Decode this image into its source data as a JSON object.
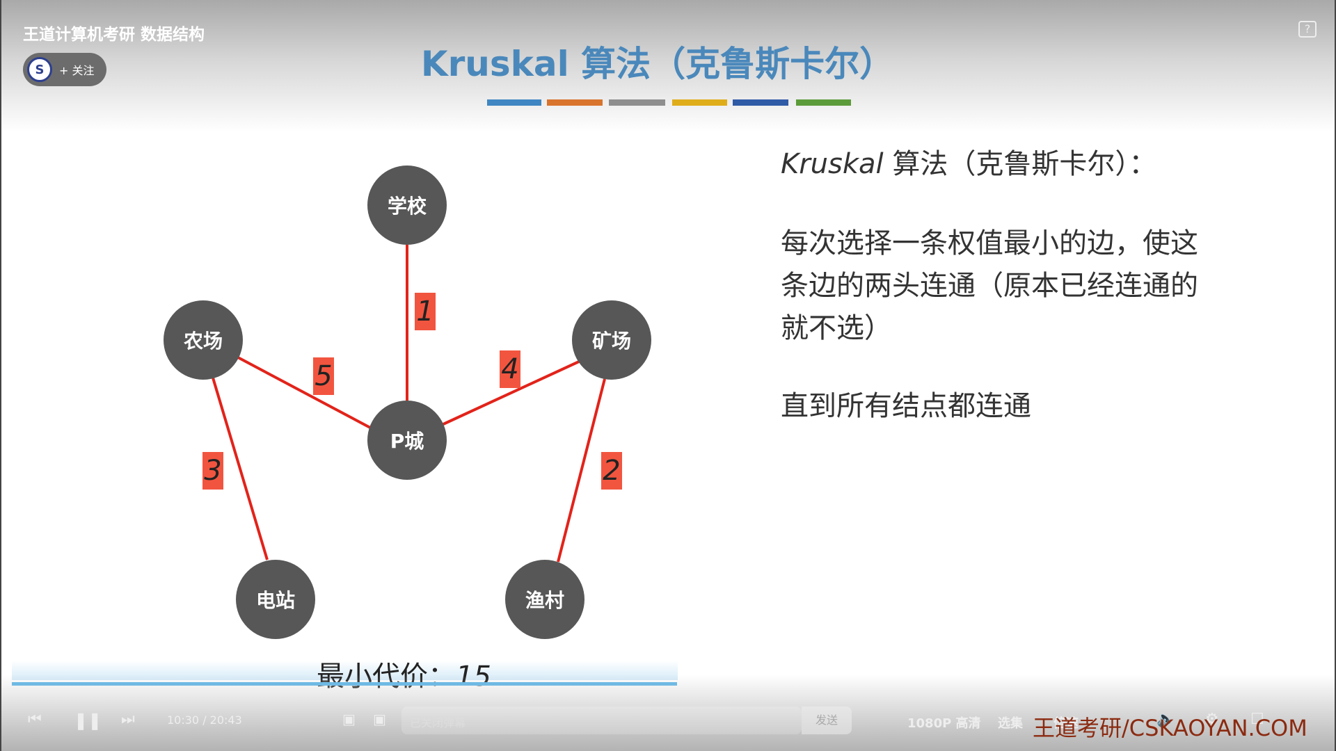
{
  "player": {
    "uploader_title": "王道计算机考研 数据结构",
    "follow_label": "+ 关注",
    "avatar_glyph": "S",
    "help_label": "?",
    "time_current": "10:30",
    "time_total": "20:43",
    "danmaku_placeholder": "已关闭弹幕",
    "send_label": "发送",
    "quality_label": "1080P 高清",
    "episodes_label": "选集",
    "speed_label": "倍速",
    "progress_percent": 49.8,
    "progress_color": "#5cb6ea"
  },
  "slide": {
    "title": "Kruskal 算法（克鲁斯卡尔）",
    "bar_colors": [
      "#3f86c3",
      "#d9742c",
      "#8e8e8e",
      "#e0ad1a",
      "#2f5aa6",
      "#5c9b3a"
    ],
    "nodes": {
      "school": "学校",
      "farm": "农场",
      "mine": "矿场",
      "pcity": "P城",
      "power": "电站",
      "fishing": "渔村"
    },
    "edges": {
      "school_p": "1",
      "fishing_mine": "2",
      "farm_power": "3",
      "p_mine": "4",
      "farm_p": "5"
    },
    "heading_italic": "Kruskal",
    "heading_rest": " 算法（克鲁斯卡尔）：",
    "para_lines": [
      "每次选择一条权值最小的边，使这",
      "条边的两头连通（原本已经连通的",
      "就不选）"
    ],
    "para2": "直到所有结点都连通",
    "cost_label": "最小代价：",
    "cost_value": "15",
    "watermark": "王道考研/CSKAOYAN.COM"
  }
}
